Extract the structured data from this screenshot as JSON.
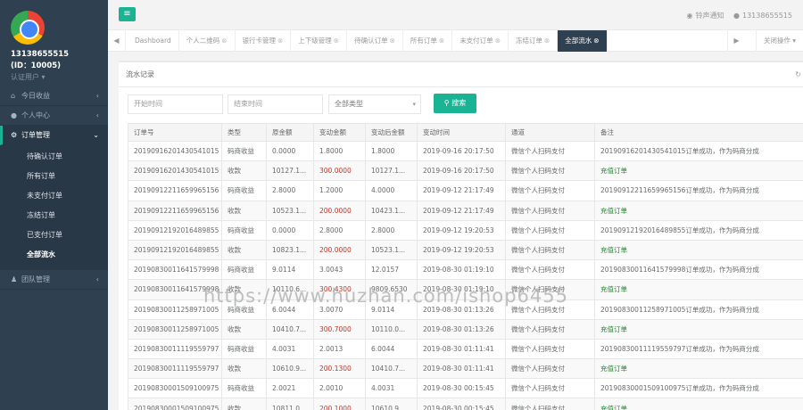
{
  "profile": {
    "phone": "13138655515",
    "id": "(ID：10005)",
    "role": "认证用户 ▾"
  },
  "nav": {
    "items": [
      {
        "label": "今日收益",
        "icon": "home-icon"
      },
      {
        "label": "个人中心",
        "icon": "user-icon"
      },
      {
        "label": "订单管理",
        "icon": "gear-icon"
      },
      {
        "label": "团队管理",
        "icon": "team-icon"
      }
    ],
    "sub_items": [
      "待确认订单",
      "所有订单",
      "未支付订单",
      "冻结订单",
      "已支付订单",
      "全部流水"
    ]
  },
  "topbar": {
    "sound": "铃声通知",
    "user": "13138655515"
  },
  "tabs": {
    "items": [
      "Dashboard",
      "个人二维码",
      "银行卡管理",
      "上下级管理",
      "待确认订单",
      "所有订单",
      "未支付订单",
      "冻结订单",
      "全部流水"
    ],
    "close_label": "关闭操作"
  },
  "panel": {
    "title": "流水记录",
    "start_placeholder": "开始时间",
    "end_placeholder": "结束时间",
    "type_selected": "全部类型",
    "search_label": "搜索"
  },
  "table": {
    "headers": [
      "订单号",
      "类型",
      "原金额",
      "变动金额",
      "变动后金额",
      "变动时间",
      "通道",
      "备注"
    ],
    "rows": [
      [
        "20190916201430541015",
        "码商收益",
        "0.0000",
        "1.8000",
        "1.8000",
        "2019-09-16 20:17:50",
        "微信个人扫码支付",
        "20190916201430541015订单成功，作为码商分成"
      ],
      [
        "20190916201430541015",
        "收款",
        "10127.1...",
        "300.0000",
        "10127.1...",
        "2019-09-16 20:17:50",
        "微信个人扫码支付",
        "充值订单"
      ],
      [
        "20190912211659965156",
        "码商收益",
        "2.8000",
        "1.2000",
        "4.0000",
        "2019-09-12 21:17:49",
        "微信个人扫码支付",
        "20190912211659965156订单成功，作为码商分成"
      ],
      [
        "20190912211659965156",
        "收款",
        "10523.1...",
        "200.0000",
        "10423.1...",
        "2019-09-12 21:17:49",
        "微信个人扫码支付",
        "充值订单"
      ],
      [
        "20190912192016489855",
        "码商收益",
        "0.0000",
        "2.8000",
        "2.8000",
        "2019-09-12 19:20:53",
        "微信个人扫码支付",
        "20190912192016489855订单成功，作为码商分成"
      ],
      [
        "20190912192016489855",
        "收款",
        "10823.1...",
        "200.0000",
        "10523.1...",
        "2019-09-12 19:20:53",
        "微信个人扫码支付",
        "充值订单"
      ],
      [
        "20190830011641579998",
        "码商收益",
        "9.0114",
        "3.0043",
        "12.0157",
        "2019-08-30 01:19:10",
        "微信个人扫码支付",
        "20190830011641579998订单成功，作为码商分成"
      ],
      [
        "20190830011641579998",
        "收款",
        "10110.6...",
        "300.4300",
        "9809.6530",
        "2019-08-30 01:19:10",
        "微信个人扫码支付",
        "充值订单"
      ],
      [
        "20190830011258971005",
        "码商收益",
        "6.0044",
        "3.0070",
        "9.0114",
        "2019-08-30 01:13:26",
        "微信个人扫码支付",
        "20190830011258971005订单成功，作为码商分成"
      ],
      [
        "20190830011258971005",
        "收款",
        "10410.7...",
        "300.7000",
        "10110.0...",
        "2019-08-30 01:13:26",
        "微信个人扫码支付",
        "充值订单"
      ],
      [
        "20190830011119559797",
        "码商收益",
        "4.0031",
        "2.0013",
        "6.0044",
        "2019-08-30 01:11:41",
        "微信个人扫码支付",
        "20190830011119559797订单成功，作为码商分成"
      ],
      [
        "20190830011119559797",
        "收款",
        "10610.9...",
        "200.1300",
        "10410.7...",
        "2019-08-30 01:11:41",
        "微信个人扫码支付",
        "充值订单"
      ],
      [
        "20190830001509100975",
        "码商收益",
        "2.0021",
        "2.0010",
        "4.0031",
        "2019-08-30 00:15:45",
        "微信个人扫码支付",
        "20190830001509100975订单成功，作为码商分成"
      ],
      [
        "20190830001509100975",
        "收款",
        "10811.0...",
        "200.1000",
        "10610.9...",
        "2019-08-30 00:15:45",
        "微信个人扫码支付",
        "充值订单"
      ]
    ]
  },
  "watermark": "https://www.huzhan.com/ishop6455",
  "colors": {
    "accent": "#1ab394",
    "sidebar": "#2f4050",
    "amount_red": "#c0392b",
    "note_green": "#1a8a2a"
  }
}
